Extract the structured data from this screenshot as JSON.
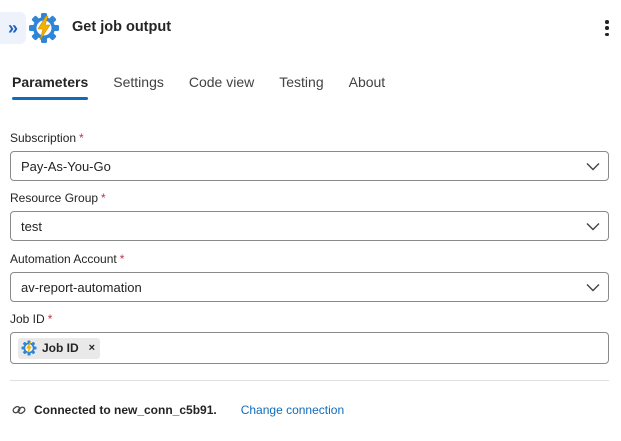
{
  "header": {
    "title": "Get job output",
    "collapse_icon": "double-chevron-right-icon",
    "app_icon": "automation-gear-lightning-icon",
    "more_icon": "more-vertical-icon"
  },
  "tabs": [
    {
      "label": "Parameters",
      "active": true
    },
    {
      "label": "Settings",
      "active": false
    },
    {
      "label": "Code view",
      "active": false
    },
    {
      "label": "Testing",
      "active": false
    },
    {
      "label": "About",
      "active": false
    }
  ],
  "fields": {
    "subscription": {
      "label": "Subscription",
      "required_mark": "*",
      "value": "Pay-As-You-Go"
    },
    "resource_group": {
      "label": "Resource Group",
      "required_mark": "*",
      "value": "test"
    },
    "automation_account": {
      "label": "Automation Account",
      "required_mark": "*",
      "value": "av-report-automation"
    },
    "job_id": {
      "label": "Job ID",
      "required_mark": "*",
      "token_label": "Job ID",
      "token_close": "×"
    }
  },
  "footer": {
    "connected_text": "Connected to new_conn_c5b91.",
    "change_link": "Change connection"
  },
  "colors": {
    "accent": "#0f6cbd",
    "required": "#c4314b",
    "icon_blue": "#2f86d8",
    "icon_bolt": "#f2b200"
  }
}
